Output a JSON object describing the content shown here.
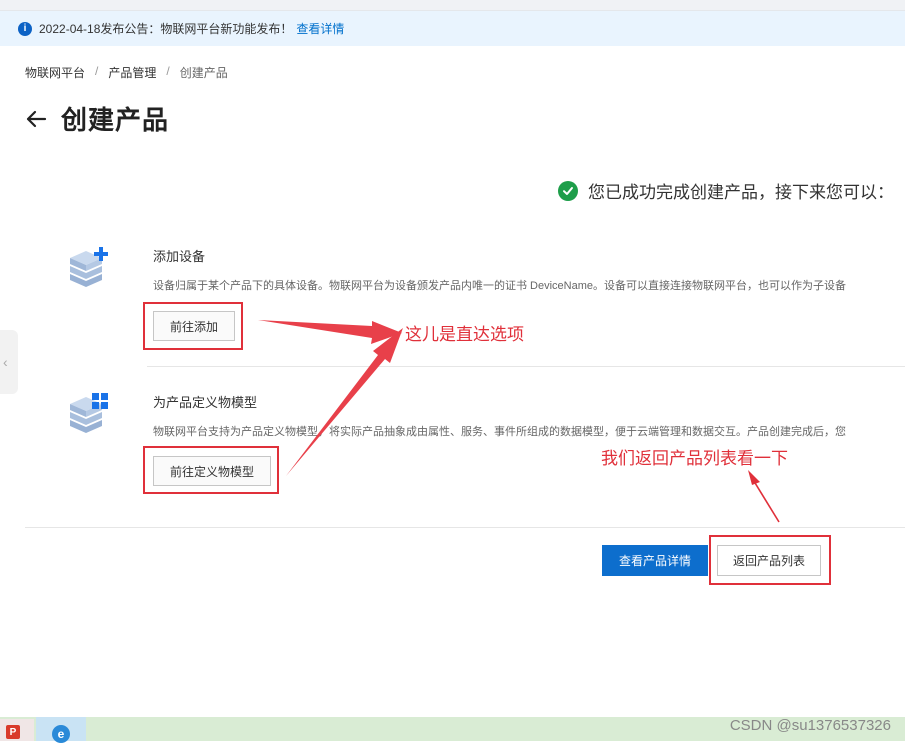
{
  "notice": {
    "text": "2022-04-18发布公告：物联网平台新功能发布！",
    "link": "查看详情"
  },
  "breadcrumb": {
    "items": [
      "物联网平台",
      "产品管理",
      "创建产品"
    ],
    "separator": "/"
  },
  "page": {
    "title": "创建产品"
  },
  "success": {
    "message": "您已成功完成创建产品，接下来您可以："
  },
  "steps": [
    {
      "title": "添加设备",
      "description": "设备归属于某个产品下的具体设备。物联网平台为设备颁发产品内唯一的证书 DeviceName。设备可以直接连接物联网平台，也可以作为子设备",
      "button": "前往添加",
      "icon": "add-device-icon"
    },
    {
      "title": "为产品定义物模型",
      "description": "物联网平台支持为产品定义物模型，将实际产品抽象成由属性、服务、事件所组成的数据模型，便于云端管理和数据交互。产品创建完成后，您",
      "button": "前往定义物模型",
      "icon": "thing-model-icon"
    }
  ],
  "actions": {
    "view_details": "查看产品详情",
    "back_to_list": "返回产品列表"
  },
  "annotations": {
    "direct_option": "这儿是直达选项",
    "go_back": "我们返回产品列表看一下"
  },
  "watermark": "CSDN @su1376537326",
  "colors": {
    "primary": "#0d6ecd",
    "annotation_red": "#e0303a",
    "success_green": "#1e9e4a",
    "notice_bg": "#e9f4fe"
  }
}
